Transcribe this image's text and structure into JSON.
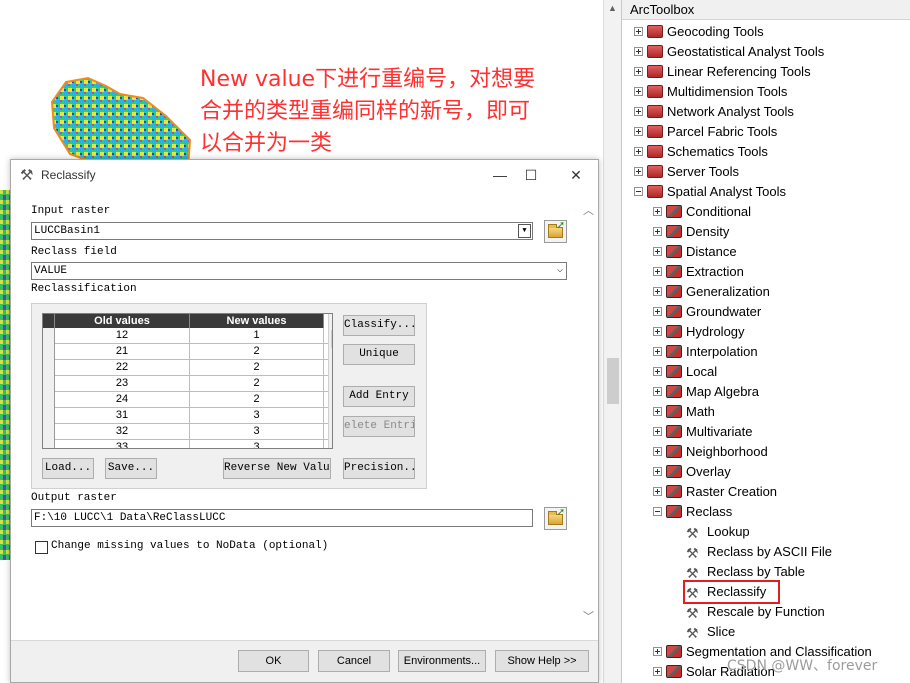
{
  "annotation": {
    "line1": "New value下进行重编号，对想要",
    "line2": "合并的类型重编同样的新号，即可",
    "line3": "以合并为一类"
  },
  "dialog": {
    "title": "Reclassify",
    "input_raster": {
      "label": "Input raster",
      "value": "LUCCBasin1"
    },
    "reclass_field": {
      "label": "Reclass field",
      "value": "VALUE"
    },
    "reclassification": {
      "label": "Reclassification",
      "columns": [
        "Old values",
        "New values"
      ],
      "rows": [
        {
          "old": "12",
          "new": "1"
        },
        {
          "old": "21",
          "new": "2"
        },
        {
          "old": "22",
          "new": "2"
        },
        {
          "old": "23",
          "new": "2"
        },
        {
          "old": "24",
          "new": "2"
        },
        {
          "old": "31",
          "new": "3"
        },
        {
          "old": "32",
          "new": "3"
        },
        {
          "old": "33",
          "new": "3"
        }
      ],
      "buttons": {
        "classify": "Classify...",
        "unique": "Unique",
        "add_entry": "Add Entry",
        "delete_entries": "elete Entrie",
        "load": "Load...",
        "save": "Save...",
        "reverse": "Reverse New Values",
        "precision": "Precision..."
      }
    },
    "output_raster": {
      "label": "Output raster",
      "value": "F:\\10 LUCC\\1 Data\\ReClassLUCC"
    },
    "change_missing": {
      "label": "Change missing values to NoData (optional)",
      "checked": false
    },
    "footer": {
      "ok": "OK",
      "cancel": "Cancel",
      "environments": "Environments...",
      "show_help": "Show Help >>"
    }
  },
  "toolbox": {
    "title": "ArcToolbox",
    "top_items": [
      "Geocoding Tools",
      "Geostatistical Analyst Tools",
      "Linear Referencing Tools",
      "Multidimension Tools",
      "Network Analyst Tools",
      "Parcel Fabric Tools",
      "Schematics Tools",
      "Server Tools"
    ],
    "spatial_analyst": "Spatial Analyst Tools",
    "sa_items": [
      "Conditional",
      "Density",
      "Distance",
      "Extraction",
      "Generalization",
      "Groundwater",
      "Hydrology",
      "Interpolation",
      "Local",
      "Map Algebra",
      "Math",
      "Multivariate",
      "Neighborhood",
      "Overlay",
      "Raster Creation"
    ],
    "reclass": "Reclass",
    "reclass_tools": [
      "Lookup",
      "Reclass by ASCII File",
      "Reclass by Table",
      "Reclassify",
      "Rescale by Function",
      "Slice"
    ],
    "bottom_items": [
      "Segmentation and Classification",
      "Solar Radiation"
    ],
    "selected_tool": "Reclassify"
  },
  "watermark": "CSDN @WW、forever"
}
